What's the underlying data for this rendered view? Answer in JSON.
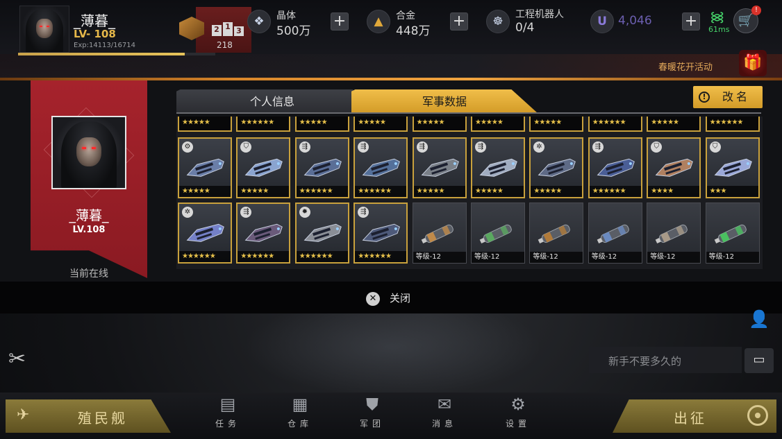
{
  "player": {
    "name": "_薄暮_",
    "level": "LV- 108",
    "exp": "Exp:14113/16714",
    "exp_ratio": 0.844,
    "rank": "218",
    "podium": [
      "2",
      "1",
      "3"
    ]
  },
  "resources": {
    "crystal": {
      "label": "晶体",
      "value": "500万"
    },
    "alloy": {
      "label": "合金",
      "value": "448万"
    },
    "robots": {
      "label": "工程机器人",
      "value": "0/4"
    },
    "u_currency": {
      "value": "4,046"
    },
    "plus_symbol": "+"
  },
  "network": {
    "ping": "61ms"
  },
  "event": {
    "label": "春暖花开活动"
  },
  "profile": {
    "name": "_薄暮_",
    "level": "LV.108",
    "status": "当前在线"
  },
  "tabs": [
    {
      "label": "个人信息",
      "active": false
    },
    {
      "label": "军事数据",
      "active": true
    }
  ],
  "rename_button": {
    "label": "改名",
    "icon": "!"
  },
  "grid": {
    "top_row_stars": [
      "★★★★★",
      "★★★★★★",
      "★★★★★",
      "★★★★★",
      "★★★★★",
      "★★★★★",
      "★★★★★",
      "★★★★★★",
      "★★★★★",
      "★★★★★★"
    ],
    "row2": [
      {
        "badge": "⚙",
        "stars": "★★★★★",
        "color": "#6a7ea8"
      },
      {
        "badge": "⛉",
        "stars": "★★★★★",
        "color": "#8aa4d0"
      },
      {
        "badge": "⇶",
        "stars": "★★★★★★",
        "color": "#5a6e96"
      },
      {
        "badge": "⇶",
        "stars": "★★★★★★",
        "color": "#54709a"
      },
      {
        "badge": "⇶",
        "stars": "★★★★★",
        "color": "#7a8088"
      },
      {
        "badge": "⇶",
        "stars": "★★★★★",
        "color": "#a0acc0"
      },
      {
        "badge": "✲",
        "stars": "★★★★★",
        "color": "#5e6a86"
      },
      {
        "badge": "⇶",
        "stars": "★★★★★★",
        "color": "#4a5e96"
      },
      {
        "badge": "⛉",
        "stars": "★★★★",
        "color": "#b08060"
      },
      {
        "badge": "⛉",
        "stars": "★★★",
        "color": "#9aa8d8"
      }
    ],
    "row3": [
      {
        "badge": "✲",
        "stars": "★★★★★★",
        "color": "#7480c8"
      },
      {
        "badge": "⇶",
        "stars": "★★★★★★",
        "color": "#6a5a7a"
      },
      {
        "badge": "✹",
        "stars": "★★★★★★",
        "color": "#8a8e96"
      },
      {
        "badge": "⇶",
        "stars": "★★★★★★",
        "color": "#4e5a7a"
      },
      {
        "label": "等级-12",
        "color": "#c08a4a"
      },
      {
        "label": "等级-12",
        "color": "#5aa860"
      },
      {
        "label": "等级-12",
        "color": "#b07a3a"
      },
      {
        "label": "等级-12",
        "color": "#6a8ac0"
      },
      {
        "label": "等级-12",
        "color": "#a89a88"
      },
      {
        "label": "等级-12",
        "color": "#4ac060"
      }
    ]
  },
  "close": {
    "label": "关闭",
    "icon": "✕"
  },
  "chat": {
    "text": "新手不要多久的"
  },
  "bottom_nav": {
    "colony": "殖民舰",
    "deploy": "出征",
    "items": [
      {
        "label": "任务",
        "icon": "task-icon",
        "glyph": "▤"
      },
      {
        "label": "仓库",
        "icon": "warehouse-icon",
        "glyph": "▦"
      },
      {
        "label": "军团",
        "icon": "legion-icon",
        "glyph": "⛊"
      },
      {
        "label": "消息",
        "icon": "message-icon",
        "glyph": "✉"
      },
      {
        "label": "设置",
        "icon": "settings-icon",
        "glyph": "⚙"
      }
    ]
  }
}
